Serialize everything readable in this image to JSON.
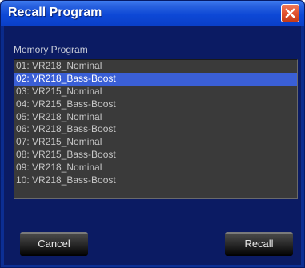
{
  "window": {
    "title": "Recall Program"
  },
  "list": {
    "label": "Memory Program",
    "selected_index": 1,
    "items": [
      "01: VR218_Nominal",
      "02: VR218_Bass-Boost",
      "03: VR215_Nominal",
      "04: VR215_Bass-Boost",
      "05: VR218_Nominal",
      "06: VR218_Bass-Boost",
      "07: VR215_Nominal",
      "08: VR215_Bass-Boost",
      "09: VR218_Nominal",
      "10: VR218_Bass-Boost"
    ]
  },
  "buttons": {
    "cancel_label": "Cancel",
    "recall_label": "Recall"
  },
  "colors": {
    "titlebar": "#0d48d6",
    "client_background": "#0b1b63",
    "list_background": "#3a3a3a",
    "selection": "#3a5fd6",
    "close_button": "#e2522f"
  },
  "icons": {
    "close": "close-icon"
  }
}
